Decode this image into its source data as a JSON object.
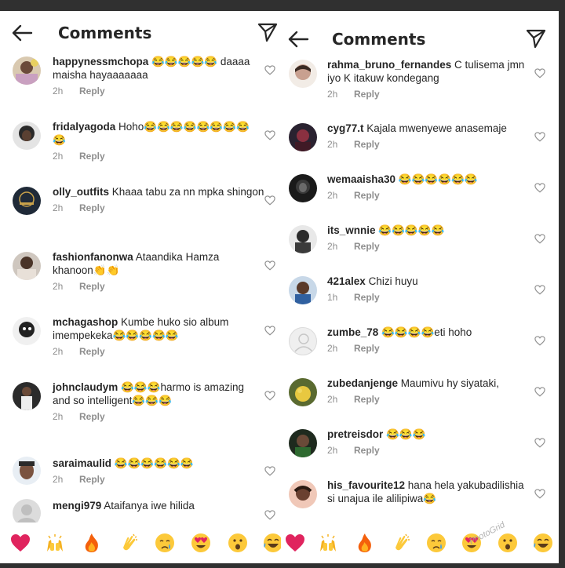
{
  "left": {
    "title": "Comments",
    "comments": [
      {
        "user": "happynessmchopa",
        "text": " 😂😂😂😂😂 daaaa maisha hayaaaaaaa",
        "time": "2h",
        "reply": "Reply"
      },
      {
        "user": "fridalyagoda",
        "text": " Hoho😂😂😂😂😂😂😂😂😂",
        "time": "2h",
        "reply": "Reply"
      },
      {
        "user": "olly_outfits",
        "text": " Khaaa tabu za nn mpka shingon",
        "time": "2h",
        "reply": "Reply"
      },
      {
        "user": "fashionfanonwa",
        "text": " Ataandika Hamza khanoon👏👏",
        "time": "2h",
        "reply": "Reply"
      },
      {
        "user": "mchagashop",
        "text": " Kumbe huko sio album imempekeka😂😂😂😂😂",
        "time": "2h",
        "reply": "Reply"
      },
      {
        "user": "johnclaudym",
        "text": " 😂😂😂harmo is amazing and so intelligent😂😂😂",
        "time": "2h",
        "reply": "Reply"
      },
      {
        "user": "saraimaulid",
        "text": " 😂😂😂😂😂😂",
        "time": "2h",
        "reply": "Reply"
      },
      {
        "user": "mengi979",
        "text": " Ataifanya iwe hilida",
        "time": "",
        "reply": ""
      }
    ]
  },
  "right": {
    "title": "Comments",
    "comments": [
      {
        "user": "rahma_bruno_fernandes",
        "text": " C tulisema jmn iyo K itakuw kondegang",
        "time": "2h",
        "reply": "Reply"
      },
      {
        "user": "cyg77.t",
        "text": " Kajala mwenyewe anasemaje",
        "time": "2h",
        "reply": "Reply"
      },
      {
        "user": "wemaaisha30",
        "text": " 😂😂😂😂😂😂",
        "time": "2h",
        "reply": "Reply"
      },
      {
        "user": "its_wnnie",
        "text": " 😂😂😂😂😂",
        "time": "2h",
        "reply": "Reply"
      },
      {
        "user": "421alex",
        "text": " Chizi huyu",
        "time": "1h",
        "reply": "Reply"
      },
      {
        "user": "zumbe_78",
        "text": " 😂😂😂😂eti hoho",
        "time": "2h",
        "reply": "Reply"
      },
      {
        "user": "zubedanjenge",
        "text": " Maumivu hy siyataki,",
        "time": "2h",
        "reply": "Reply"
      },
      {
        "user": "pretreisdor",
        "text": " 😂😂😂",
        "time": "2h",
        "reply": "Reply"
      },
      {
        "user": "his_favourite12",
        "text": " hana hela yakubadilishia si unajua ile alilipiwa😂",
        "time": "",
        "reply": ""
      }
    ]
  },
  "watermark": "PhotoGrid",
  "colors": {
    "background": "#303030",
    "panel": "#ffffff",
    "text": "#262626",
    "muted": "#8e8e8e"
  },
  "icons": {
    "back": "back-arrow-icon",
    "send": "send-paper-plane-icon",
    "like": "heart-outline-icon"
  }
}
